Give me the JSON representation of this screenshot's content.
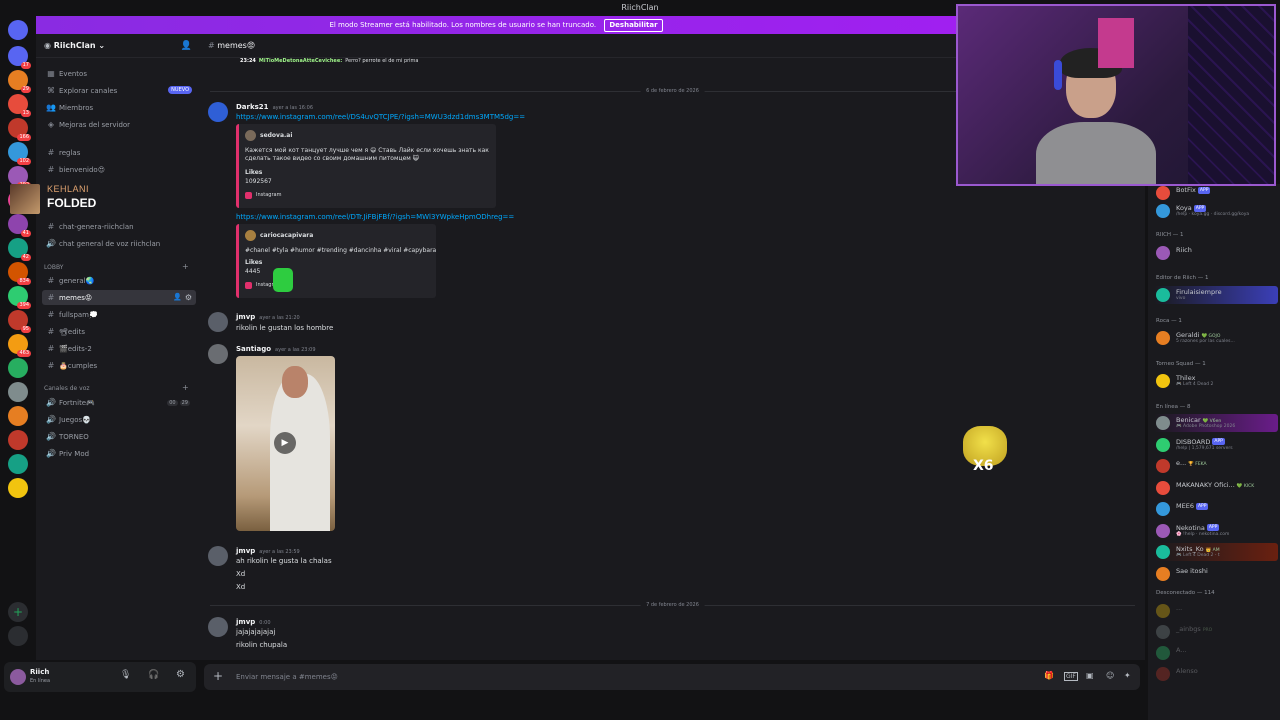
{
  "window": {
    "title": "RiichClan"
  },
  "streamer_banner": {
    "text": "El modo Streamer está habilitado. Los nombres de usuario se han truncado.",
    "button": "Deshabilitar"
  },
  "server": {
    "name": "RiichClan"
  },
  "sidebar": {
    "top_items": [
      {
        "label": "Eventos",
        "icon": "calendar-icon"
      },
      {
        "label": "Explorar canales",
        "icon": "explore-icon",
        "badge": "NUEVO"
      },
      {
        "label": "Miembros",
        "icon": "members-icon"
      },
      {
        "label": "Mejoras del servidor",
        "icon": "boost-icon"
      }
    ],
    "channels_a": [
      {
        "label": "reglas"
      },
      {
        "label": "bienvenido😍"
      }
    ],
    "now_playing": {
      "artist": "KEHLANI",
      "title": "FOLDED"
    },
    "channels_b": [
      {
        "label": "chat-genera-riichclan"
      },
      {
        "label": "chat general de voz riichclan"
      }
    ],
    "lobby_label": "LOBBY",
    "lobby": [
      {
        "label": "general🌏"
      },
      {
        "label": "memes😡"
      },
      {
        "label": "fullspam💭"
      },
      {
        "label": "📽edits"
      },
      {
        "label": "🎬edits-2"
      },
      {
        "label": "🎂cumples"
      }
    ],
    "voice_label": "Canales de voz",
    "voice": [
      {
        "label": "Fortnite🎮",
        "counts": [
          "00",
          "29"
        ]
      },
      {
        "label": "Juegos💀"
      },
      {
        "label": "TORNEO"
      },
      {
        "label": "Priv Mod"
      }
    ]
  },
  "user_panel": {
    "name": "Riich",
    "status": "En línea"
  },
  "rail_badges": [
    "17",
    "29",
    "13",
    "166",
    "102",
    "292",
    "1K",
    "41",
    "42",
    "834",
    "394",
    "95",
    "463"
  ],
  "chat": {
    "channel": "memes😡",
    "prev_msg": {
      "time": "23:24",
      "author": "MiTioMeDetonaAtteCevichee:",
      "text": "Perro? perrote el de mi prima"
    },
    "date1": "6 de febrero de 2026",
    "messages": [
      {
        "author": "Darks21",
        "time": "ayer a las 16:06",
        "link1": "https://www.instagram.com/reel/DS4uvQTCJPE/?igsh=MWU3dzd1dms3MTM5dg==",
        "embed1": {
          "account": "sedova.ai",
          "text1": "Кажется мой кот танцует лучше чем я 😄 Ставь Лайк если хочешь знать как",
          "text2": "сделать такое видео со своим домашним питомцем 😺",
          "likes_label": "Likes",
          "likes": "1092567",
          "source": "Instagram"
        },
        "link2": "https://www.instagram.com/reel/DTr.JiFBjFBf/?igsh=MWl3YWpkeHpmODhreg==",
        "embed2": {
          "account": "cariocacapivara",
          "text1": "#chanel #tyla #humor #trending #dancinha #viral #capybara",
          "likes_label": "Likes",
          "likes": "4445",
          "source": "Instagram"
        }
      },
      {
        "author": "jmvp",
        "time": "ayer a las 21:20",
        "lines": [
          "rikolin le gustan los hombre"
        ]
      },
      {
        "author": "Santiago",
        "time": "ayer a las 23:09"
      },
      {
        "author": "jmvp",
        "time": "ayer a las 23:59",
        "lines": [
          "ah rikolin le gusta la chalas",
          "Xd",
          "Xd"
        ]
      }
    ],
    "date2": "7 de febrero de 2026",
    "last": {
      "author": "jmvp",
      "time": "0:00",
      "lines": [
        "jajajajajajaj",
        "rikolin chupala"
      ]
    },
    "composer_placeholder": "Enviar mensaje a #memes😡"
  },
  "members": {
    "top": [
      {
        "name": "BotFix",
        "tag": "APP"
      },
      {
        "name": "Koya",
        "tag": "APP",
        "sub": "/help · koya.gg · discord.gg/koya"
      }
    ],
    "g1": "RIICH — 1",
    "g1_members": [
      {
        "name": "Riich"
      }
    ],
    "g2": "Editor de Riich — 1",
    "g2_members": [
      {
        "name": "Firulaisiempre",
        "sub": "vivo"
      }
    ],
    "g3": "Roca — 1",
    "g3_members": [
      {
        "name": "Geraldi",
        "extra": "💚 GOJO",
        "sub": "5 razones por las cuales..."
      }
    ],
    "g4": "Torneo Squad — 1",
    "g4_members": [
      {
        "name": "Thilex",
        "sub": "🎮 Left 4 Dead 2"
      }
    ],
    "g5": "En línea — 8",
    "g5_members": [
      {
        "name": "Benicar",
        "extra": "💚 V6en",
        "sub": "🎮 Adobe Photoshop 2026"
      },
      {
        "name": "DISBOARD",
        "tag": "APP",
        "sub": "/help | 1,579,671 servers"
      },
      {
        "name": "e...",
        "extra": "🏆 FEKA"
      },
      {
        "name": "MAKANAKY Ofici...",
        "extra": "💚 KICK"
      },
      {
        "name": "MEE6",
        "tag": "APP"
      },
      {
        "name": "Nekotina",
        "tag": "APP",
        "sub": "🌸 !help · nekotina.com"
      },
      {
        "name": "Nxits_Ko",
        "extra": "👑 AM",
        "sub": "🎮 Left 4 Dead 2 - t"
      },
      {
        "name": "Sae itoshi"
      }
    ],
    "g6": "Desconectado — 114",
    "g6_members": [
      {
        "name": "..."
      },
      {
        "name": "_ainbgs",
        "extra": "PRO"
      },
      {
        "name": "A..."
      },
      {
        "name": "Alenso"
      }
    ]
  },
  "sticker": {
    "label": "X6"
  },
  "colors": {
    "brand": "#5865f2",
    "accent_purple": "#a020f0",
    "link": "#00a8fc",
    "instagram": "#e1306c"
  }
}
